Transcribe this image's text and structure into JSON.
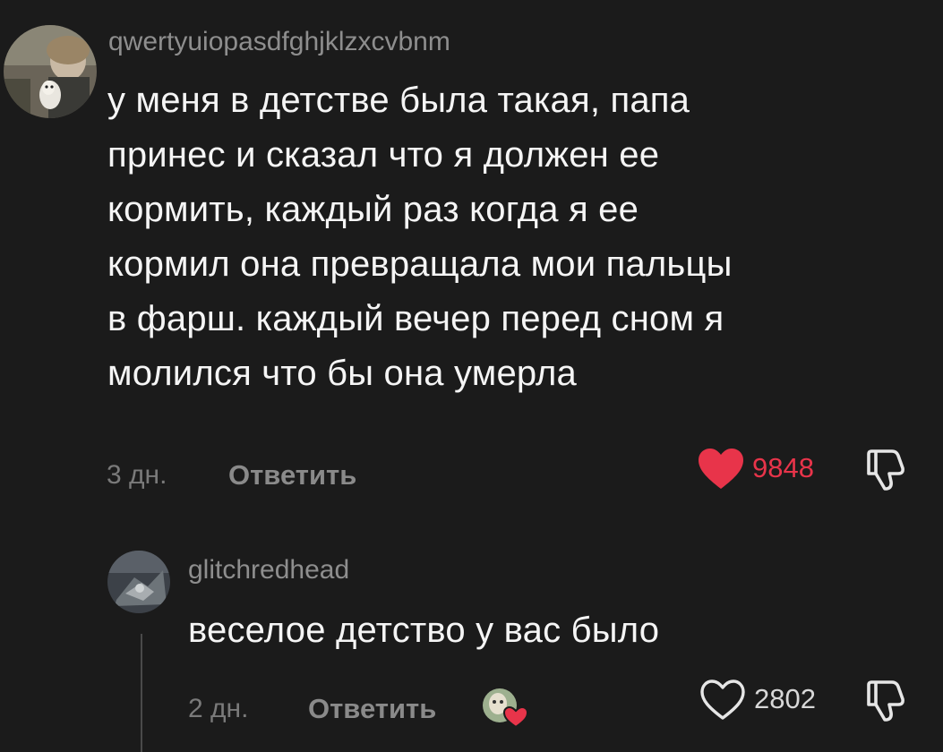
{
  "comments": [
    {
      "username": "qwertyuiopasdfghjklzxcvbnm",
      "text_lines": [
        "у меня в детстве была такая, папа",
        "принес и сказал что я должен ее",
        "кормить, каждый раз когда я ее",
        "кормил она превращала мои пальцы",
        "в фарш. каждый вечер перед сном я",
        "молился что бы она умерла"
      ],
      "time": "3 дн.",
      "reply_label": "Ответить",
      "like_count": "9848",
      "liked": true,
      "like_icon": "heart-filled-icon",
      "dislike_icon": "thumbs-down-icon",
      "like_color": "#e8344a",
      "like_count_color": "#e8344a"
    },
    {
      "username": "glitchredhead",
      "text_lines": [
        "веселое детство у вас было"
      ],
      "time": "2 дн.",
      "reply_label": "Ответить",
      "like_count": "2802",
      "liked": false,
      "like_icon": "heart-outline-icon",
      "dislike_icon": "thumbs-down-icon",
      "creator_like_badge": "creator-liked-avatar-icon"
    }
  ]
}
